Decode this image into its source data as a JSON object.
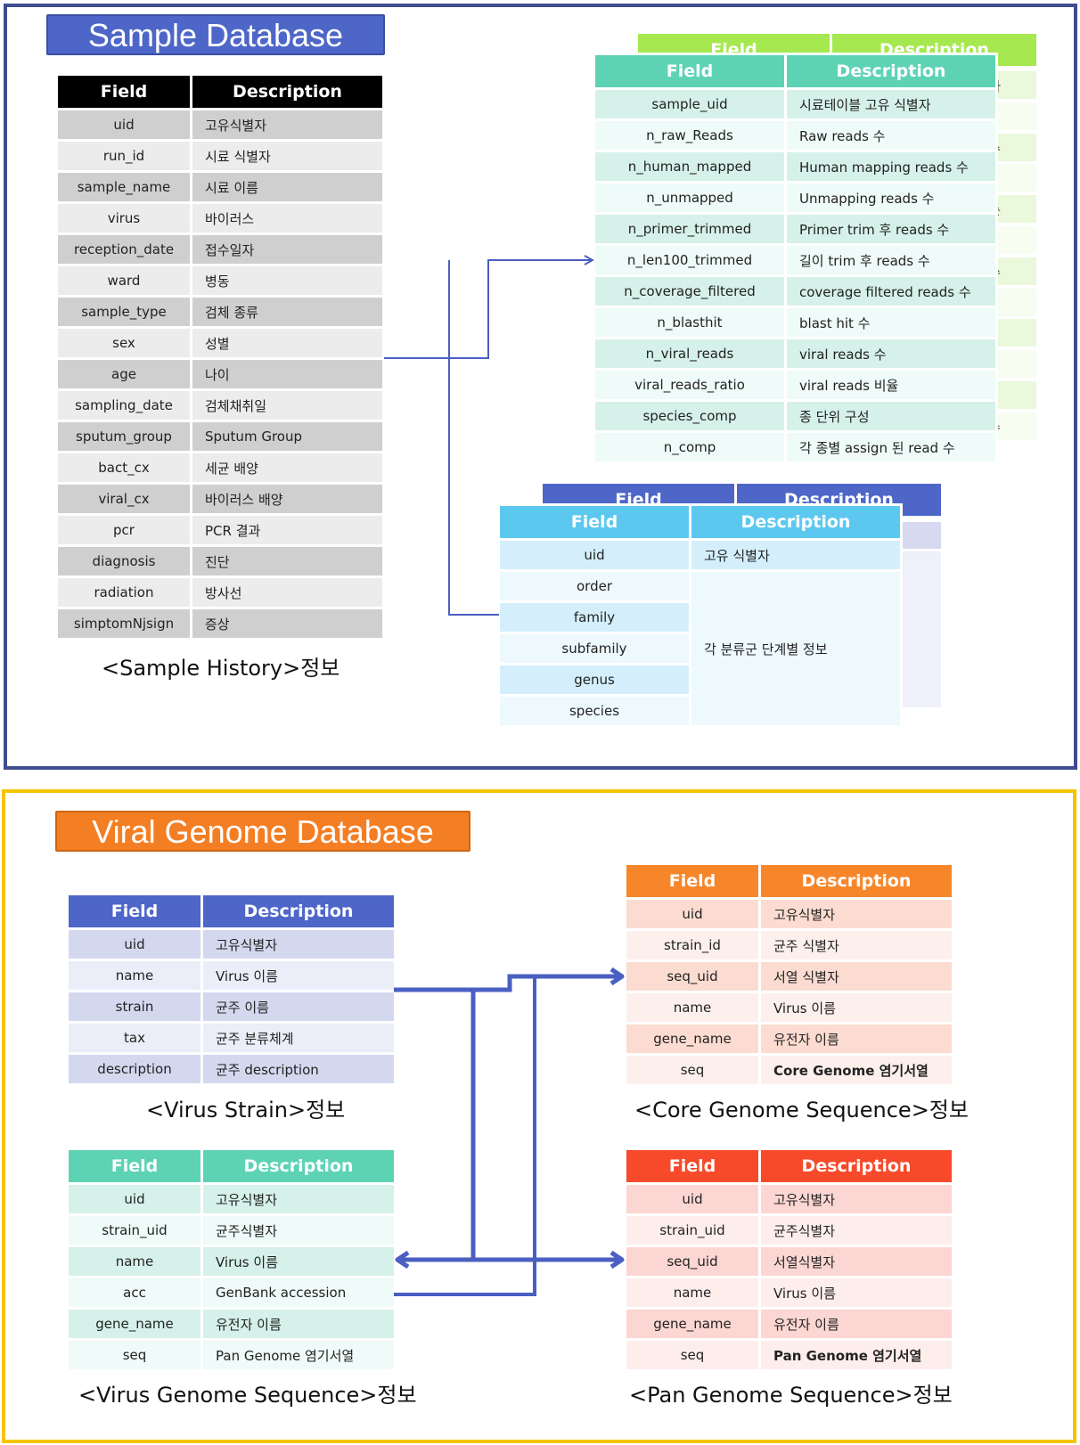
{
  "sample_db": {
    "title": "Sample Database",
    "headers": {
      "field": "Field",
      "description": "Description"
    },
    "sample_history": {
      "caption": "<Sample History>정보",
      "rows": [
        {
          "field": "uid",
          "description": "고유식별자"
        },
        {
          "field": "run_id",
          "description": "시료 식별자"
        },
        {
          "field": "sample_name",
          "description": "시료 이름"
        },
        {
          "field": "virus",
          "description": "바이러스"
        },
        {
          "field": "reception_date",
          "description": "접수일자"
        },
        {
          "field": "ward",
          "description": "병동"
        },
        {
          "field": "sample_type",
          "description": "검체 종류"
        },
        {
          "field": "sex",
          "description": "성별"
        },
        {
          "field": "age",
          "description": "나이"
        },
        {
          "field": "sampling_date",
          "description": "검체채취일"
        },
        {
          "field": "sputum_group",
          "description": "Sputum Group"
        },
        {
          "field": "bact_cx",
          "description": "세균 배양"
        },
        {
          "field": "viral_cx",
          "description": "바이러스 배양"
        },
        {
          "field": "pcr",
          "description": "PCR 결과"
        },
        {
          "field": "diagnosis",
          "description": "진단"
        },
        {
          "field": "radiation",
          "description": "방사선"
        },
        {
          "field": "simptomNjsign",
          "description": "증상"
        }
      ]
    },
    "reads_table": {
      "rows": [
        {
          "field": "sample_uid",
          "description": "시료테이블 고유 식별자"
        },
        {
          "field": "n_raw_Reads",
          "description": "Raw reads 수"
        },
        {
          "field": "n_human_mapped",
          "description": "Human mapping reads 수"
        },
        {
          "field": "n_unmapped",
          "description": "Unmapping reads 수"
        },
        {
          "field": "n_primer_trimmed",
          "description": "Primer trim 후 reads 수"
        },
        {
          "field": "n_len100_trimmed",
          "description": "길이 trim 후 reads 수"
        },
        {
          "field": "n_coverage_filtered",
          "description": "coverage filtered reads 수"
        },
        {
          "field": "n_blasthit",
          "description": "blast hit 수"
        },
        {
          "field": "n_viral_reads",
          "description": "viral reads 수"
        },
        {
          "field": "viral_reads_ratio",
          "description": "viral reads 비율"
        },
        {
          "field": "species_comp",
          "description": "종 단위 구성"
        },
        {
          "field": "n_comp",
          "description": "각 종별 assign 된 read 수"
        }
      ],
      "behind_fragments": [
        "자",
        "; 수",
        "는",
        "; 수",
        "수"
      ]
    },
    "taxonomy_table": {
      "uid_row": {
        "field": "uid",
        "description": "고유 식별자"
      },
      "rank_fields": [
        "order",
        "family",
        "subfamily",
        "genus",
        "species"
      ],
      "rank_description": "각 분류군 단계별 정보"
    }
  },
  "viral_db": {
    "title": "Viral Genome Database",
    "headers": {
      "field": "Field",
      "description": "Description"
    },
    "virus_strain": {
      "caption": "<Virus Strain>정보",
      "rows": [
        {
          "field": "uid",
          "description": "고유식별자"
        },
        {
          "field": "name",
          "description": "Virus 이름"
        },
        {
          "field": "strain",
          "description": "균주 이름"
        },
        {
          "field": "tax",
          "description": "균주 분류체계"
        },
        {
          "field": "description",
          "description": "균주 description"
        }
      ]
    },
    "virus_genome_sequence": {
      "caption": "<Virus Genome Sequence>정보",
      "rows": [
        {
          "field": "uid",
          "description": "고유식별자"
        },
        {
          "field": "strain_uid",
          "description": "균주식별자"
        },
        {
          "field": "name",
          "description": "Virus 이름"
        },
        {
          "field": "acc",
          "description": "GenBank accession"
        },
        {
          "field": "gene_name",
          "description": "유전자 이름"
        },
        {
          "field": "seq",
          "description": "Pan Genome 염기서열"
        }
      ]
    },
    "core_genome_sequence": {
      "caption": "<Core Genome Sequence>정보",
      "rows": [
        {
          "field": "uid",
          "description": "고유식별자"
        },
        {
          "field": "strain_id",
          "description": "균주 식별자"
        },
        {
          "field": "seq_uid",
          "description": "서열 식별자"
        },
        {
          "field": "name",
          "description": "Virus 이름"
        },
        {
          "field": "gene_name",
          "description": "유전자 이름"
        },
        {
          "field": "seq",
          "description": "Core Genome 염기서열"
        }
      ]
    },
    "pan_genome_sequence": {
      "caption": "<Pan Genome Sequence>정보",
      "rows": [
        {
          "field": "uid",
          "description": "고유식별자"
        },
        {
          "field": "strain_uid",
          "description": "균주식별자"
        },
        {
          "field": "seq_uid",
          "description": "서열식별자"
        },
        {
          "field": "name",
          "description": "Virus 이름"
        },
        {
          "field": "gene_name",
          "description": "유전자 이름"
        },
        {
          "field": "seq",
          "description": "Pan Genome 염기서열"
        }
      ]
    }
  },
  "colors": {
    "sample_panel_border": "#3f4c8f",
    "viral_panel_border": "#f5c400",
    "sample_banner": "#4d66c8",
    "viral_banner": "#f47e23",
    "connector": "#4a5fc1"
  }
}
